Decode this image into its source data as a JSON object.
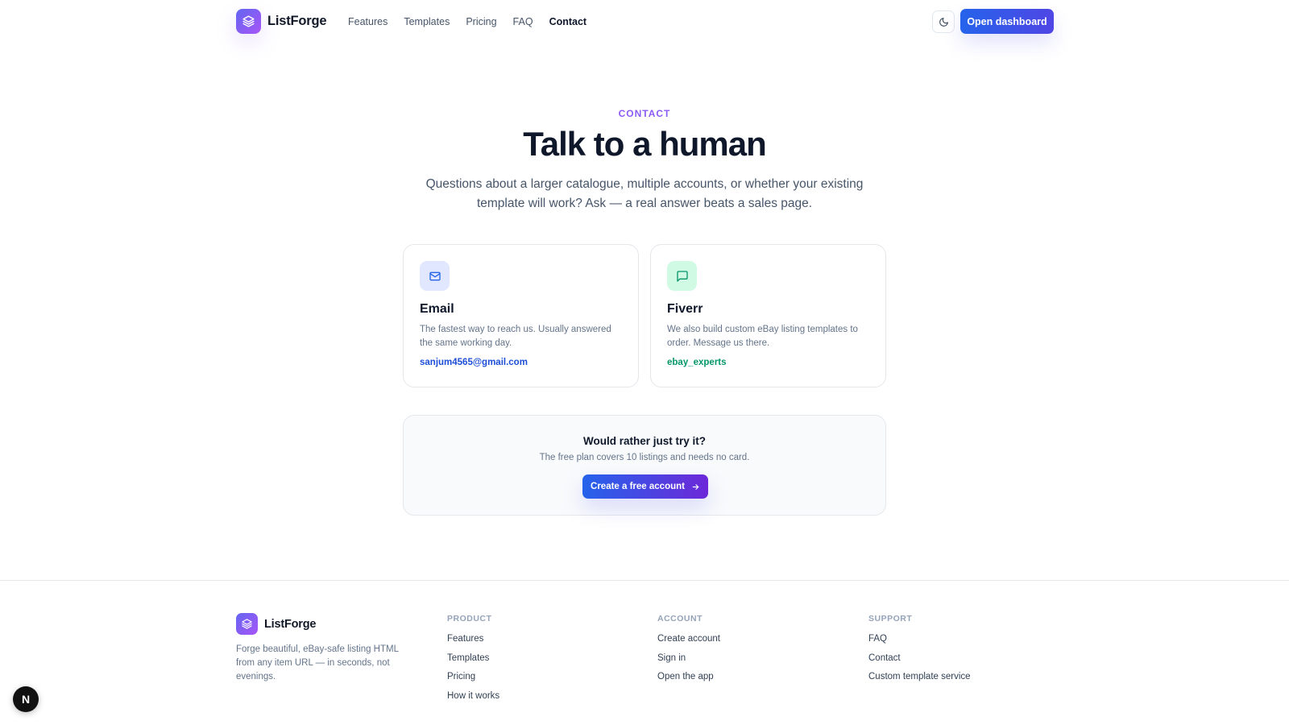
{
  "header": {
    "brand": "ListForge",
    "nav": [
      "Features",
      "Templates",
      "Pricing",
      "FAQ",
      "Contact"
    ],
    "active_nav": "Contact",
    "theme_icon": "moon-icon",
    "cta_label": "Open dashboard"
  },
  "hero": {
    "eyebrow": "CONTACT",
    "title": "Talk to a human",
    "subtitle": "Questions about a larger catalogue, multiple accounts, or whether your existing template will work? Ask — a real answer beats a sales page."
  },
  "cards": [
    {
      "icon": "mail-icon",
      "title": "Email",
      "description": "The fastest way to reach us. Usually answered the same working day.",
      "link": "sanjum4565@gmail.com"
    },
    {
      "icon": "message-icon",
      "title": "Fiverr",
      "description": "We also build custom eBay listing templates to order. Message us there.",
      "link": "ebay_experts"
    }
  ],
  "cta": {
    "title": "Would rather just try it?",
    "text": "The free plan covers 10 listings and needs no card.",
    "button": "Create a free account",
    "button_icon": "arrow-right-icon"
  },
  "footer": {
    "brand": "ListForge",
    "tagline": "Forge beautiful, eBay-safe listing HTML from any item URL — in seconds, not evenings.",
    "columns": [
      {
        "heading": "PRODUCT",
        "links": [
          "Features",
          "Templates",
          "Pricing",
          "How it works"
        ]
      },
      {
        "heading": "ACCOUNT",
        "links": [
          "Create account",
          "Sign in",
          "Open the app"
        ]
      },
      {
        "heading": "SUPPORT",
        "links": [
          "FAQ",
          "Contact",
          "Custom template service"
        ]
      }
    ]
  },
  "floating_badge": "N",
  "colors": {
    "accent": "#4f46e5",
    "brand_gradient_start": "#6366f1",
    "brand_gradient_end": "#a855f7",
    "email_link": "#1d4ed8",
    "fiverr_link": "#059669"
  }
}
